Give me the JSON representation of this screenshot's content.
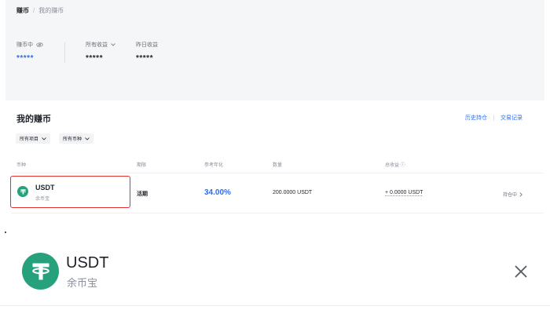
{
  "breadcrumb": {
    "root": "赚币",
    "separator": "/",
    "current": "我的赚币"
  },
  "summary": {
    "earning": {
      "label": "赚币中",
      "value": "*****",
      "icon": "eye-off-icon"
    },
    "all_earnings": {
      "label": "所有收益",
      "value": "*****",
      "icon": "chevron-down-icon"
    },
    "yesterday": {
      "label": "昨日收益",
      "value": "*****"
    }
  },
  "section": {
    "title": "我的赚币",
    "links": {
      "history": "历史持仓",
      "records": "交易记录"
    }
  },
  "filters": {
    "project": "所有项目",
    "currency": "所有币种"
  },
  "table": {
    "headers": {
      "currency": "币种",
      "term": "期限",
      "apr": "参考年化",
      "amount": "数量",
      "total": "总收益"
    },
    "rows": [
      {
        "asset": "USDT",
        "product": "余币宝",
        "term": "活期",
        "apr": "34.00%",
        "amount": "200.0000 USDT",
        "total": "+ 0.0000 USDT",
        "status": "持仓中"
      }
    ]
  },
  "detail": {
    "asset": "USDT",
    "product": "余币宝",
    "close_icon": "close-icon"
  },
  "colors": {
    "accent": "#2b6ef5",
    "tether": "#26a17b",
    "highlight": "#e0332d"
  }
}
